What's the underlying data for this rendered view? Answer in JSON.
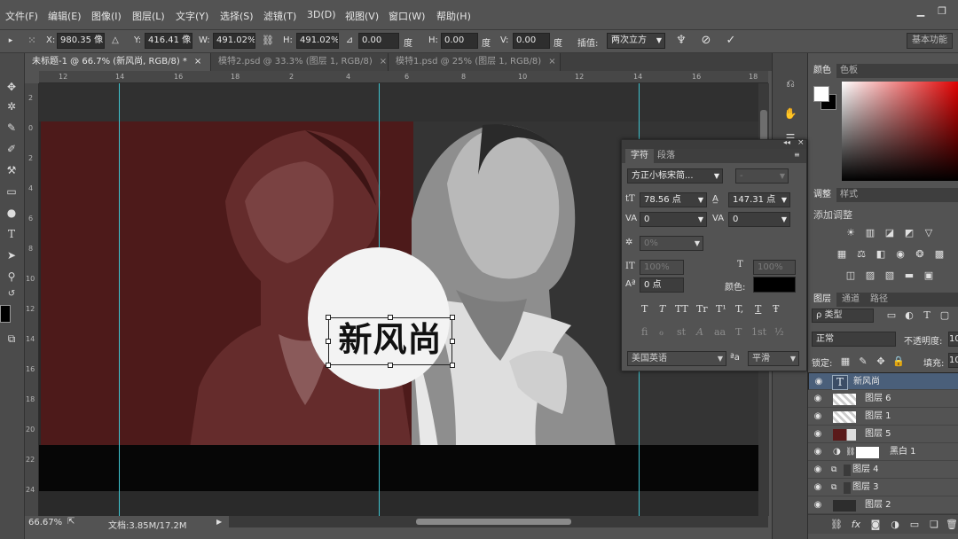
{
  "menu": [
    "文件(F)",
    "编辑(E)",
    "图像(I)",
    "图层(L)",
    "文字(Y)",
    "选择(S)",
    "滤镜(T)",
    "3D(D)",
    "视图(V)",
    "窗口(W)",
    "帮助(H)"
  ],
  "options": {
    "x_label": "X:",
    "x_value": "980.35 像",
    "y_label": "Y:",
    "y_value": "416.41 像",
    "w_label": "W:",
    "w_value": "491.02%",
    "h_label": "H:",
    "h_value": "491.02%",
    "angle_value": "0.00",
    "deg1": "度",
    "hskew_label": "H:",
    "hskew_value": "0.00",
    "deg2": "度",
    "vskew_label": "V:",
    "vskew_value": "0.00",
    "deg3": "度",
    "interp_label": "插值:",
    "interp_value": "两次立方",
    "workspace": "基本功能"
  },
  "tabs": [
    {
      "label": "未标题-1 @ 66.7% (新风尚, RGB/8) *",
      "close": "×"
    },
    {
      "label": "模特2.psd @ 33.3% (图层 1, RGB/8)",
      "close": "×"
    },
    {
      "label": "模特1.psd @ 25% (图层 1, RGB/8)",
      "close": "×"
    }
  ],
  "ruler_h": [
    "12",
    "14",
    "16",
    "18",
    "2",
    "4",
    "6",
    "8",
    "10",
    "12",
    "14",
    "16",
    "18"
  ],
  "ruler_v": [
    "2",
    "0",
    "2",
    "4",
    "6",
    "8",
    "10",
    "12",
    "14",
    "16",
    "18",
    "20",
    "22",
    "24"
  ],
  "canvas": {
    "headline": "新风尚"
  },
  "status": {
    "zoom": "66.67%",
    "doc": "文档:3.85M/17.2M"
  },
  "color_panel": {
    "tab1": "颜色",
    "tab2": "色板"
  },
  "adjust_panel": {
    "tab1": "调整",
    "tab2": "样式",
    "add_label": "添加调整"
  },
  "char_panel": {
    "tab1": "字符",
    "tab2": "段落",
    "font_family": "方正小标宋简...",
    "font_style": "-",
    "size": "78.56 点",
    "leading": "147.31 点",
    "kerning": "0",
    "tracking": "0",
    "tsume": "0%",
    "vscale": "100%",
    "hscale": "100%",
    "baseline": "0 点",
    "color_label": "颜色:",
    "color": "#000000",
    "language": "美国英语",
    "aa_icon": "ªa",
    "antialias": "平滑",
    "fmt_buttons": [
      "T",
      "T",
      "TT",
      "Tr",
      "T¹",
      "T,",
      "T",
      "Ŧ"
    ],
    "ot_buttons": [
      "fi",
      "ℴ",
      "st",
      "A",
      "aa",
      "T",
      "1st",
      "½"
    ]
  },
  "layers_panel": {
    "tab1": "图层",
    "tab2": "通道",
    "tab3": "路径",
    "filter": "ρ 类型",
    "blend": "正常",
    "opacity_label": "不透明度:",
    "opacity_value": "10",
    "lock_label": "锁定:",
    "fill_label": "填充:",
    "fill_value": "10",
    "layers": [
      {
        "name": "新风尚",
        "kind": "text",
        "selected": true
      },
      {
        "name": "图层 6",
        "kind": "transparent"
      },
      {
        "name": "图层 1",
        "kind": "transparent"
      },
      {
        "name": "图层 5",
        "kind": "red"
      },
      {
        "name": "黑白 1",
        "kind": "adjust"
      },
      {
        "name": "图层 4",
        "kind": "photo"
      },
      {
        "name": "图层 3",
        "kind": "photo"
      },
      {
        "name": "图层 2",
        "kind": "dark"
      }
    ]
  }
}
